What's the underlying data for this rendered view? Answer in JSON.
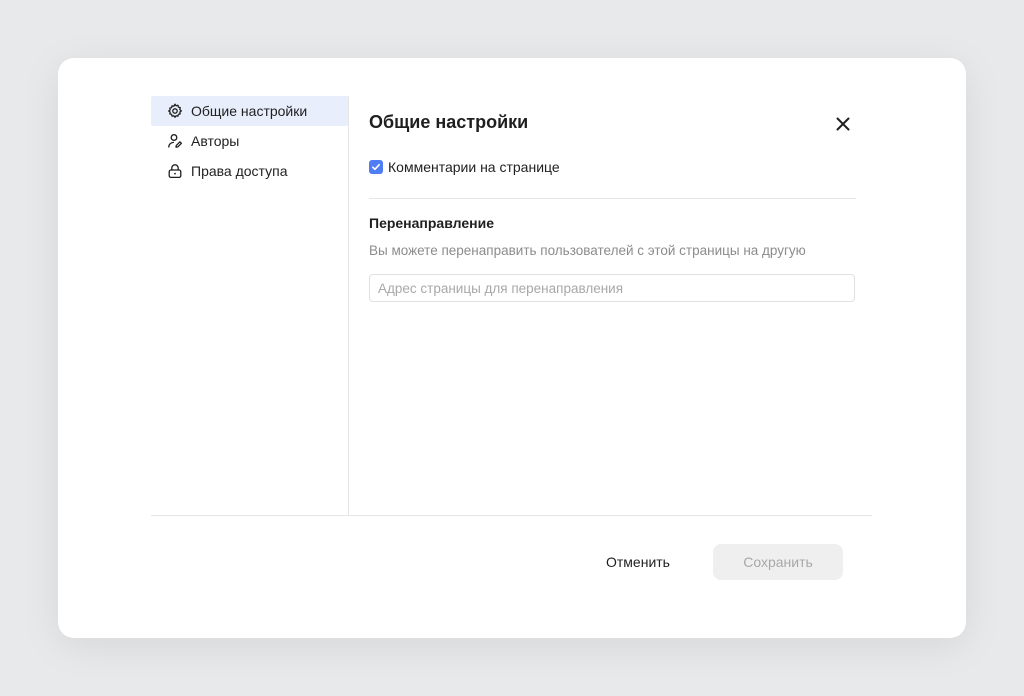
{
  "sidebar": {
    "items": [
      {
        "label": "Общие настройки",
        "icon": "gear-icon",
        "active": true
      },
      {
        "label": "Авторы",
        "icon": "user-edit-icon",
        "active": false
      },
      {
        "label": "Права доступа",
        "icon": "lock-icon",
        "active": false
      }
    ]
  },
  "main": {
    "title": "Общие настройки",
    "comments_checkbox": {
      "label": "Комментарии на странице",
      "checked": true
    },
    "redirect": {
      "title": "Перенаправление",
      "description": "Вы можете перенаправить пользователей с этой страницы на другую",
      "input_value": "",
      "placeholder": "Адрес страницы для перенаправления"
    }
  },
  "footer": {
    "cancel_label": "Отменить",
    "save_label": "Сохранить"
  },
  "colors": {
    "accent": "#4f7df3",
    "active_bg": "#e8eefc",
    "page_bg": "#e8e9eb"
  },
  "icons": {
    "close": "close-icon",
    "check": "check-icon"
  }
}
